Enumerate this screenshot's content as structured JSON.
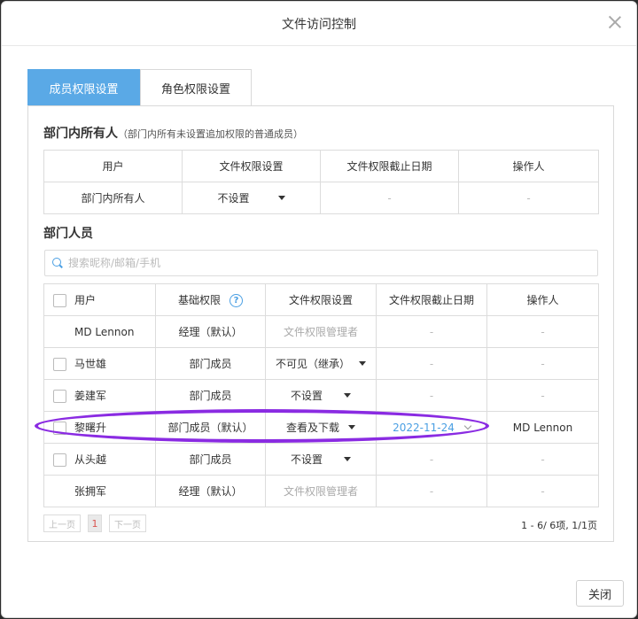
{
  "dialog": {
    "title": "文件访问控制",
    "close_label": "关闭"
  },
  "tabs": [
    {
      "label": "成员权限设置",
      "active": true
    },
    {
      "label": "角色权限设置",
      "active": false
    }
  ],
  "owners_section": {
    "title": "部门内所有人",
    "note": "（部门内所有未设置追加权限的普通成员）",
    "columns": [
      "用户",
      "文件权限设置",
      "文件权限截止日期",
      "操作人"
    ],
    "row": {
      "user": "部门内所有人",
      "permission": "不设置",
      "deadline": "-",
      "operator": "-"
    }
  },
  "members_section": {
    "title": "部门人员",
    "search_placeholder": "搜索昵称/邮箱/手机",
    "columns": [
      "用户",
      "基础权限",
      "文件权限设置",
      "文件权限截止日期",
      "操作人"
    ],
    "help_glyph": "?",
    "rows": [
      {
        "user": "MD Lennon",
        "checkbox": false,
        "base": "经理（默认）",
        "permission": "文件权限管理者",
        "permission_dropdown": false,
        "deadline": "-",
        "operator": "-"
      },
      {
        "user": "马世雄",
        "checkbox": true,
        "base": "部门成员",
        "permission": "不可见（继承）",
        "permission_dropdown": true,
        "deadline": "-",
        "operator": "-"
      },
      {
        "user": "姜建军",
        "checkbox": true,
        "base": "部门成员",
        "permission": "不设置",
        "permission_dropdown": true,
        "deadline": "-",
        "operator": "-"
      },
      {
        "user": "黎曙升",
        "checkbox": true,
        "base": "部门成员（默认）",
        "permission": "查看及下载",
        "permission_dropdown": true,
        "deadline": "2022-11-24",
        "operator": "MD Lennon",
        "highlighted": true
      },
      {
        "user": "从头越",
        "checkbox": true,
        "base": "部门成员",
        "permission": "不设置",
        "permission_dropdown": true,
        "deadline": "-",
        "operator": "-"
      },
      {
        "user": "张拥军",
        "checkbox": false,
        "base": "经理（默认）",
        "permission": "文件权限管理者",
        "permission_dropdown": false,
        "deadline": "-",
        "operator": "-"
      }
    ]
  },
  "pagination": {
    "prev": "上一页",
    "current": "1",
    "next": "下一页",
    "info": "1 - 6/ 6项, 1/1页"
  },
  "colors": {
    "accent": "#5aa9e6",
    "highlight_ring": "#8a2be2",
    "page_number": "#d9534f"
  }
}
